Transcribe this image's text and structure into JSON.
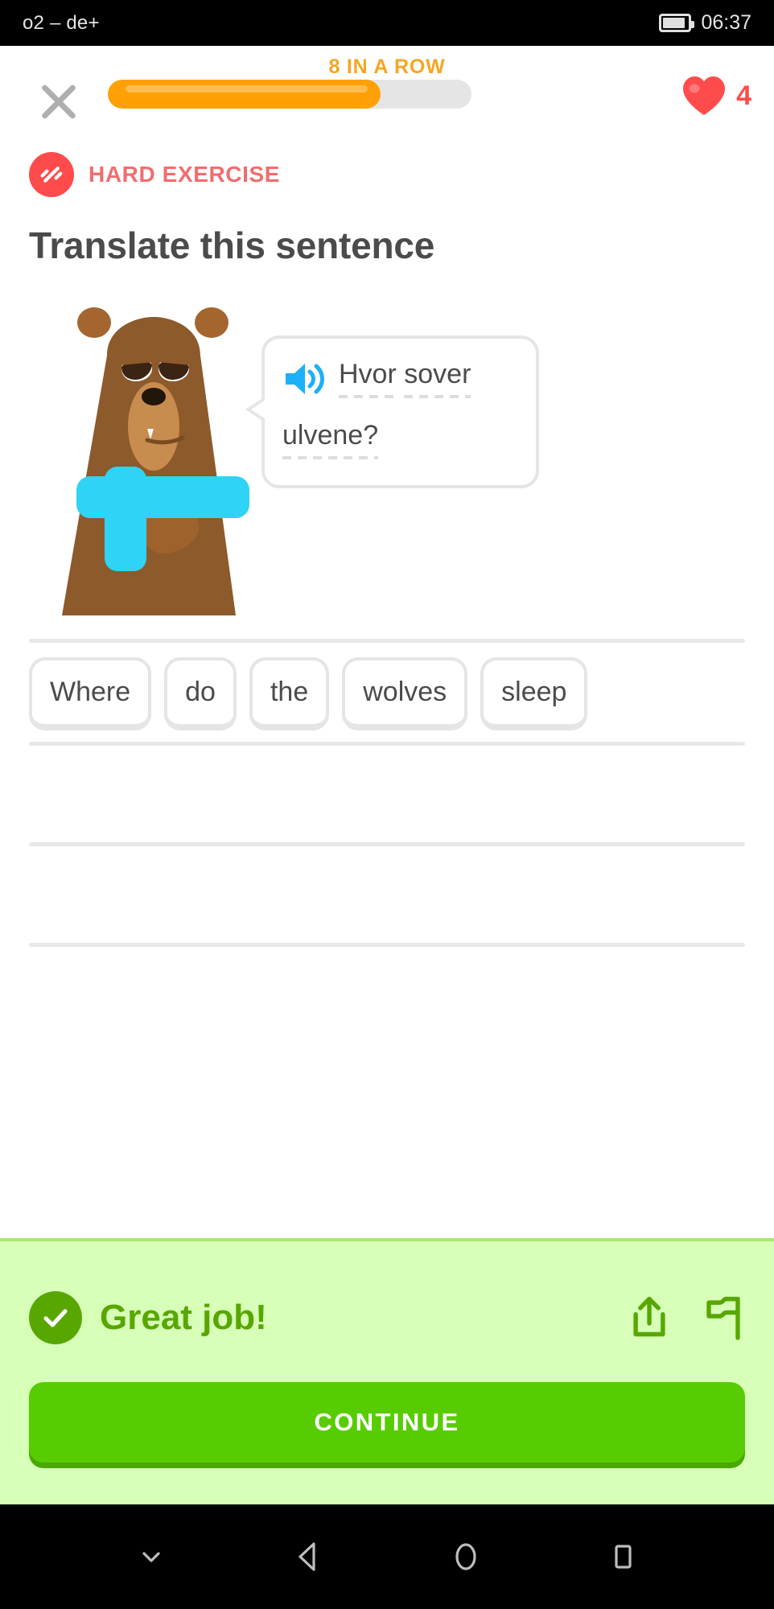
{
  "status_bar": {
    "carrier": "o2 – de+",
    "time": "06:37",
    "battery_icon": "battery-icon"
  },
  "top_bar": {
    "streak_label": "8 IN A ROW",
    "close_icon": "close-icon",
    "progress_percent": 75,
    "heart_icon": "heart-icon",
    "hearts_count": "4",
    "accent_orange": "#ffa005",
    "heart_red": "#ff4b4b"
  },
  "exercise": {
    "badge_label": "HARD EXERCISE",
    "badge_icon": "dumbbell-icon",
    "badge_color": "#ef6e6e",
    "title": "Translate this sentence",
    "character": "bear-character",
    "prompt": {
      "speaker_icon": "speaker-icon",
      "line1_word1": "Hvor",
      "line1_word2": "sover",
      "line2_word1": "ulvene?",
      "full_text": "Hvor sover ulvene?"
    }
  },
  "word_bank": {
    "tiles": [
      {
        "label": "Where"
      },
      {
        "label": "do"
      },
      {
        "label": "the"
      },
      {
        "label": "wolves"
      },
      {
        "label": "sleep"
      }
    ],
    "answer_lines": 3
  },
  "footer": {
    "check_icon": "check-circle-icon",
    "result_text": "Great job!",
    "share_icon": "share-icon",
    "report_icon": "flag-icon",
    "continue_label": "CONTINUE",
    "background": "#d7ffb8",
    "result_green": "#58a700",
    "button_green": "#58cc02"
  },
  "nav_bar": {
    "hide_keyboard_icon": "chevron-down-icon",
    "back_icon": "back-triangle-icon",
    "home_icon": "home-circle-icon",
    "recents_icon": "recents-square-icon"
  }
}
